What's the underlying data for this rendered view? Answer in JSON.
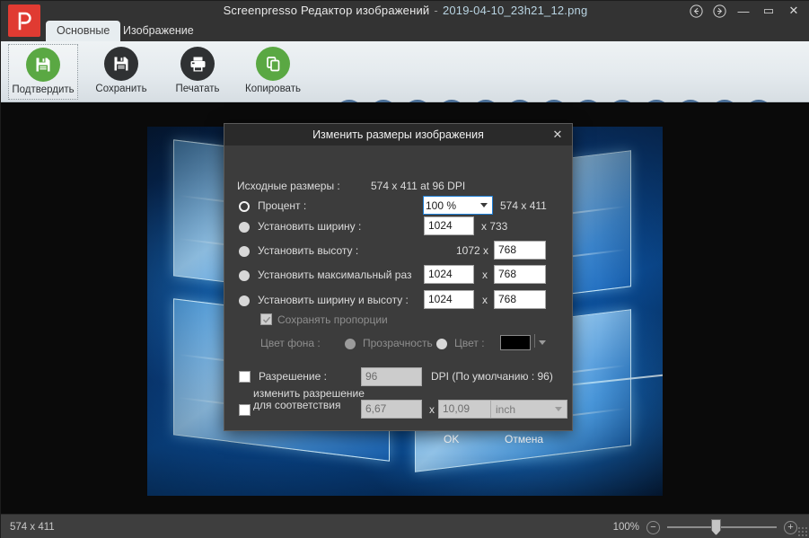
{
  "window": {
    "app_title": "Screenpresso Редактор изображений",
    "separator": "-",
    "filename": "2019-04-10_23h21_12.png",
    "logo_icon": "screenpresso-logo-icon",
    "nav_back_icon": "arrow-back-circle-icon",
    "nav_forward_icon": "arrow-forward-circle-icon",
    "minimize_label": "—",
    "maximize_label": "▭",
    "close_label": "✕"
  },
  "tabs": [
    {
      "label": "Основные",
      "active": true
    },
    {
      "label": "Изображение",
      "active": false
    }
  ],
  "ribbon": {
    "big_buttons": [
      {
        "label": "Подтвердить",
        "icon": "save-confirm-icon",
        "style": "green",
        "selected": true
      },
      {
        "label": "Сохранить",
        "icon": "floppy-disk-icon",
        "style": "dark",
        "selected": false
      },
      {
        "label": "Печатать",
        "icon": "printer-icon",
        "style": "dark",
        "selected": false
      },
      {
        "label": "Копировать",
        "icon": "copy-icon",
        "style": "green",
        "selected": false
      }
    ],
    "overflow_caret_icon": "chevron-down-icon",
    "tools": [
      {
        "icon": "arrow-tool-icon"
      },
      {
        "icon": "rectangle-tool-icon"
      },
      {
        "icon": "text-tool-icon"
      },
      {
        "icon": "speech-bubble-tool-icon"
      },
      {
        "icon": "numbered-step-tool-icon"
      },
      {
        "icon": "highlighter-tool-icon"
      },
      {
        "icon": "ellipse-tool-icon"
      },
      {
        "icon": "polygon-tool-icon"
      },
      {
        "icon": "freehand-tool-icon"
      },
      {
        "icon": "blur-drop-tool-icon"
      },
      {
        "icon": "image-insert-tool-icon"
      },
      {
        "icon": "magnifier-tool-icon"
      },
      {
        "icon": "brace-tool-icon"
      }
    ]
  },
  "dialog": {
    "title": "Изменить размеры изображения",
    "close_icon": "close-icon",
    "original_size_label": "Исходные размеры :",
    "original_size_value": "574 x 411 at 96 DPI",
    "rows": [
      {
        "label": "Процент :",
        "radio_selected": true,
        "combo_value": "100 %",
        "result": "574 x 411"
      },
      {
        "label": "Установить ширину :",
        "radio_selected": false,
        "value": "1024",
        "result": "x 733"
      },
      {
        "label": "Установить высоту :",
        "radio_selected": false,
        "prefix": "1072 x",
        "value": "768"
      },
      {
        "label": "Установить максимальный раз",
        "radio_selected": false,
        "value_w": "1024",
        "x": "x",
        "value_h": "768"
      },
      {
        "label": "Установить ширину и высоту :",
        "radio_selected": false,
        "value_w": "1024",
        "x": "x",
        "value_h": "768"
      }
    ],
    "keep_ratio_label": "Сохранять пропорции",
    "keep_ratio_checked": true,
    "bg_color_label": "Цвет фона :",
    "transparency_label": "Прозрачность",
    "color_label": "Цвет :",
    "color_swatch_hex": "#000000",
    "resolution_label": "Разрешение :",
    "resolution_value": "96",
    "resolution_hint": "DPI (По умолчанию : 96)",
    "resolution_checked": false,
    "match_res_label": "изменить разрешение для соответствия",
    "match_res_checked": false,
    "match_w": "6,67",
    "match_x": "x",
    "match_h": "10,09",
    "match_unit": "inch",
    "ok_label": "OK",
    "cancel_label": "Отмена"
  },
  "statusbar": {
    "dimensions": "574 x 411",
    "zoom_label": "100%",
    "zoom_out_icon": "minus-circle-icon",
    "zoom_in_icon": "plus-circle-icon",
    "zoom_out_label": "−",
    "zoom_in_label": "+",
    "resize-grip": "resize-grip-icon"
  },
  "colors": {
    "accent_green": "#5aa843",
    "tool_blue": "#4a6e96",
    "logo_red": "#e03b32",
    "dialog_bg": "#3c3c3c",
    "selection_blue": "#2196f3"
  }
}
